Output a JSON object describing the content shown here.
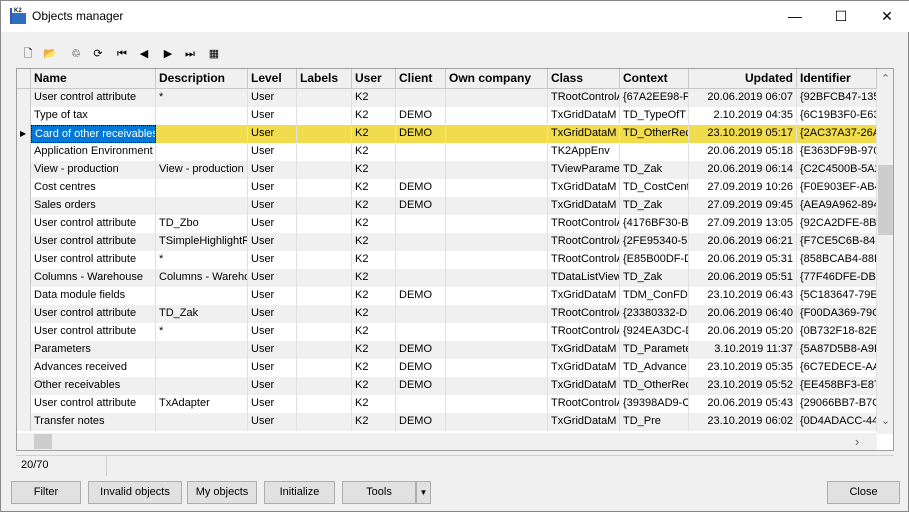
{
  "window": {
    "title": "Objects manager",
    "minimize": "—",
    "maximize": "☐",
    "close": "✕"
  },
  "toolbar": [
    {
      "icon": "new-icon",
      "glyph": "🗋"
    },
    {
      "icon": "open-folder-icon",
      "glyph": "📂"
    },
    {
      "icon": "delete-icon",
      "glyph": "♲"
    },
    {
      "icon": "refresh-icon",
      "glyph": "⟳"
    },
    {
      "icon": "first-record-icon",
      "glyph": "⏮"
    },
    {
      "icon": "prior-record-icon",
      "glyph": "◀"
    },
    {
      "icon": "next-record-icon",
      "glyph": "▶"
    },
    {
      "icon": "last-record-icon",
      "glyph": "⏭"
    },
    {
      "icon": "excel-export-icon",
      "glyph": "▦"
    }
  ],
  "columns": [
    "Name",
    "Description",
    "Level",
    "Labels",
    "User",
    "Client",
    "Own company",
    "Class",
    "Context",
    "Updated",
    "Identifier"
  ],
  "rows": [
    [
      "User control attribute",
      "*",
      "User",
      "",
      "K2",
      "",
      "",
      "TRootControlA",
      "{67A2EE98-F",
      "20.06.2019 06:07",
      "{92BFCB47-135"
    ],
    [
      "Type of tax",
      "",
      "User",
      "",
      "K2",
      "DEMO",
      "",
      "TxGridDataM",
      "TD_TypeOfT",
      "2.10.2019 04:35",
      "{6C19B3F0-E63"
    ],
    [
      "Card of other receivables",
      "",
      "User",
      "",
      "K2",
      "DEMO",
      "",
      "TxGridDataM",
      "TD_OtherRec",
      "23.10.2019 05:17",
      "{2AC37A37-26A"
    ],
    [
      "Application Environment",
      "",
      "User",
      "",
      "K2",
      "",
      "",
      "TK2AppEnv",
      "",
      "20.06.2019 05:18",
      "{E363DF9B-970"
    ],
    [
      "View - production",
      "View - production",
      "User",
      "",
      "K2",
      "",
      "",
      "TViewParamet",
      "TD_Zak",
      "20.06.2019 06:14",
      "{C2C4500B-5A2"
    ],
    [
      "Cost centres",
      "",
      "User",
      "",
      "K2",
      "DEMO",
      "",
      "TxGridDataM",
      "TD_CostCent",
      "27.09.2019 10:26",
      "{F0E903EF-AB4"
    ],
    [
      "Sales orders",
      "",
      "User",
      "",
      "K2",
      "DEMO",
      "",
      "TxGridDataM",
      "TD_Zak",
      "27.09.2019 09:45",
      "{AEA9A962-894"
    ],
    [
      "User control attribute",
      "TD_Zbo",
      "User",
      "",
      "K2",
      "",
      "",
      "TRootControlA",
      "{4176BF30-BI",
      "27.09.2019 13:05",
      "{92CA2DFE-8BE"
    ],
    [
      "User control attribute",
      "TSimpleHighlightR",
      "User",
      "",
      "K2",
      "",
      "",
      "TRootControlA",
      "{2FE95340-5:",
      "20.06.2019 06:21",
      "{F7CE5C6B-841"
    ],
    [
      "User control attribute",
      "*",
      "User",
      "",
      "K2",
      "",
      "",
      "TRootControlA",
      "{E85B00DF-D",
      "20.06.2019 05:31",
      "{858BCAB4-88D"
    ],
    [
      "Columns - Warehouse",
      "Columns - Wareho",
      "User",
      "",
      "K2",
      "",
      "",
      "TDataListView",
      "TD_Zak",
      "20.06.2019 05:51",
      "{77F46DFE-DB1"
    ],
    [
      "Data module fields",
      "",
      "User",
      "",
      "K2",
      "DEMO",
      "",
      "TxGridDataM",
      "TDM_ConFDI",
      "23.10.2019 06:43",
      "{5C183647-79E"
    ],
    [
      "User control attribute",
      "TD_Zak",
      "User",
      "",
      "K2",
      "",
      "",
      "TRootControlA",
      "{23380332-DI",
      "20.06.2019 06:40",
      "{F00DA369-79C"
    ],
    [
      "User control attribute",
      "*",
      "User",
      "",
      "K2",
      "",
      "",
      "TRootControlA",
      "{924EA3DC-D",
      "20.06.2019 05:20",
      "{0B732F18-82E"
    ],
    [
      "Parameters",
      "",
      "User",
      "",
      "K2",
      "DEMO",
      "",
      "TxGridDataM",
      "TD_Paramete",
      "3.10.2019 11:37",
      "{5A87D5B8-A9E"
    ],
    [
      "Advances received",
      "",
      "User",
      "",
      "K2",
      "DEMO",
      "",
      "TxGridDataM",
      "TD_Advance",
      "23.10.2019 05:35",
      "{6C7EDECE-AA"
    ],
    [
      "Other receivables",
      "",
      "User",
      "",
      "K2",
      "DEMO",
      "",
      "TxGridDataM",
      "TD_OtherRec",
      "23.10.2019 05:52",
      "{EE458BF3-E87"
    ],
    [
      "User control attribute",
      "TxAdapter",
      "User",
      "",
      "K2",
      "",
      "",
      "TRootControlA",
      "{39398AD9-C",
      "20.06.2019 05:43",
      "{29066BB7-B7C"
    ],
    [
      "Transfer notes",
      "",
      "User",
      "",
      "K2",
      "DEMO",
      "",
      "TxGridDataM",
      "TD_Pre",
      "23.10.2019 06:02",
      "{0D4ADACC-44"
    ]
  ],
  "selected_row": 2,
  "colors": {
    "selected": "#f0dc4c",
    "alt_row": "#f0f0f0"
  },
  "status": {
    "count": "20/70"
  },
  "buttons": {
    "filter": "Filter",
    "invalid": "Invalid objects",
    "my": "My objects",
    "initialize": "Initialize",
    "tools": "Tools",
    "tools_arrow": "▼",
    "close": "Close"
  },
  "scroll": {
    "up": "⌃",
    "down": "⌄",
    "right": "›"
  }
}
